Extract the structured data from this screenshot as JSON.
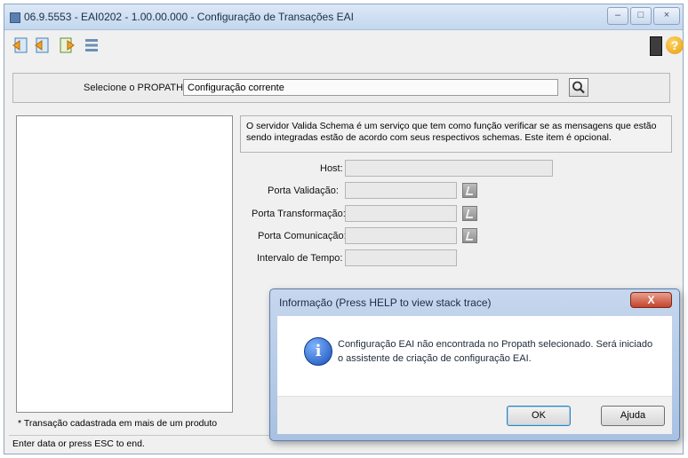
{
  "window": {
    "title": "06.9.5553 - EAI0202 - 1.00.00.000 - Configuração de Transações EAI"
  },
  "form": {
    "propath_label": "Selecione o PROPATH:",
    "propath_value": "Configuração corrente",
    "description": "O servidor Valida Schema é um serviço que tem como função verificar se as mensagens que estão sendo integradas estão de acordo com seus respectivos schemas. Este item é opcional.",
    "fields": {
      "host": "Host:",
      "porta_validacao": "Porta Validação:",
      "porta_transformacao": "Porta Transformação:",
      "porta_comunicacao": "Porta Comunicação:",
      "intervalo": "Intervalo de Tempo:"
    },
    "footnote": "* Transação cadastrada em mais de um produto"
  },
  "toolbar": {
    "help_glyph": "?"
  },
  "status_bar": {
    "text": "Enter data or press ESC to end."
  },
  "dialog": {
    "title": "Informação (Press HELP to view stack trace)",
    "close_glyph": "X",
    "icon_glyph": "i",
    "message": "Configuração EAI não encontrada no Propath selecionado. Será iniciado o assistente de criação de configuração EAI.",
    "ok_label": "OK",
    "help_label": "Ajuda"
  }
}
